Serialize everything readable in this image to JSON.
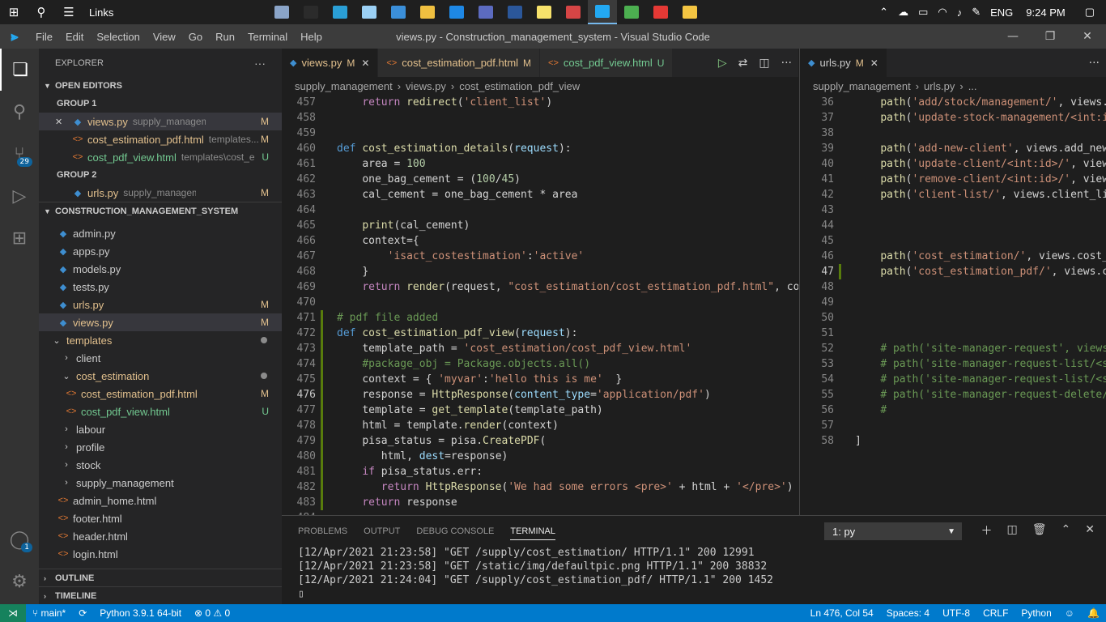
{
  "taskbar": {
    "links_label": "Links",
    "language": "ENG",
    "time": "9:24 PM",
    "apps": [
      {
        "name": "photos-app-icon",
        "color": "#8aa4c8"
      },
      {
        "name": "terminal-app-icon",
        "color": "#2b2b2b"
      },
      {
        "name": "edge-app-icon",
        "color": "#2a9fd6"
      },
      {
        "name": "notepad-app-icon",
        "color": "#9bd0f5"
      },
      {
        "name": "pc-app-icon",
        "color": "#3b8fd9"
      },
      {
        "name": "store-app-icon",
        "color": "#f0c040"
      },
      {
        "name": "mail-app-icon",
        "color": "#1e88e5"
      },
      {
        "name": "calculator-app-icon",
        "color": "#5c6bc0"
      },
      {
        "name": "word-app-icon",
        "color": "#2b579a"
      },
      {
        "name": "sticky-notes-app-icon",
        "color": "#f7e26b"
      },
      {
        "name": "cloud-app-icon",
        "color": "#d64545"
      },
      {
        "name": "vscode-app-icon",
        "color": "#23a9f2"
      },
      {
        "name": "chrome-app-icon",
        "color": "#4caf50"
      },
      {
        "name": "opera-app-icon",
        "color": "#e53935"
      },
      {
        "name": "explorer-app-icon",
        "color": "#f4c542"
      }
    ]
  },
  "titlebar": {
    "logo": "⫸",
    "menu": [
      "File",
      "Edit",
      "Selection",
      "View",
      "Go",
      "Run",
      "Terminal",
      "Help"
    ],
    "window_title": "views.py - Construction_management_system - Visual Studio Code"
  },
  "activity": {
    "scm_badge": "29",
    "account_badge": "1"
  },
  "sidebar": {
    "title": "EXPLORER",
    "open_editors": "OPEN EDITORS",
    "group1": "GROUP 1",
    "group2": "GROUP 2",
    "g1": [
      {
        "name": "views.py",
        "desc": "supply_management",
        "status": "M",
        "type": "py",
        "close": "✕"
      },
      {
        "name": "cost_estimation_pdf.html",
        "desc": "templates...",
        "status": "M",
        "type": "html"
      },
      {
        "name": "cost_pdf_view.html",
        "desc": "templates\\cost_e...",
        "status": "U",
        "type": "html"
      }
    ],
    "g2": [
      {
        "name": "urls.py",
        "desc": "supply_management",
        "status": "M",
        "type": "py"
      }
    ],
    "project": "CONSTRUCTION_MANAGEMENT_SYSTEM",
    "tree": [
      {
        "name": "admin.py",
        "status": ""
      },
      {
        "name": "apps.py",
        "status": ""
      },
      {
        "name": "models.py",
        "status": ""
      },
      {
        "name": "tests.py",
        "status": ""
      },
      {
        "name": "urls.py",
        "status": "M"
      },
      {
        "name": "views.py",
        "status": "M"
      }
    ],
    "templates": "templates",
    "folders_top": [
      "client"
    ],
    "cost_estimation": "cost_estimation",
    "ce_files": [
      {
        "name": "cost_estimation_pdf.html",
        "status": "M"
      },
      {
        "name": "cost_pdf_view.html",
        "status": "U"
      }
    ],
    "folders_bottom": [
      "labour",
      "profile",
      "stock",
      "supply_management"
    ],
    "html_files": [
      "admin_home.html",
      "footer.html",
      "header.html",
      "login.html"
    ],
    "outline": "OUTLINE",
    "timeline": "TIMELINE"
  },
  "editor1": {
    "tabs": [
      {
        "name": "views.py",
        "status": "M",
        "type": "py",
        "active": true
      },
      {
        "name": "cost_estimation_pdf.html",
        "status": "M",
        "type": "html"
      },
      {
        "name": "cost_pdf_view.html",
        "status": "U",
        "type": "html"
      }
    ],
    "breadcrumb": [
      "supply_management",
      "›",
      "views.py",
      "›",
      "cost_estimation_pdf_view"
    ],
    "current_line": "476",
    "lines": [
      {
        "n": "457",
        "html": "    <span class='kw2'>return</span> <span class='fn'>redirect</span><span class='plain'>(</span><span class='str'>'client_list'</span><span class='plain'>)</span>"
      },
      {
        "n": "458",
        "html": ""
      },
      {
        "n": "459",
        "html": ""
      },
      {
        "n": "460",
        "html": "<span class='kw'>def</span> <span class='fn'>cost_estimation_details</span><span class='plain'>(</span><span class='var'>request</span><span class='plain'>):</span>"
      },
      {
        "n": "461",
        "html": "    <span class='plain'>area = </span><span class='num'>100</span>"
      },
      {
        "n": "462",
        "html": "    <span class='plain'>one_bag_cement = (</span><span class='num'>100</span><span class='plain'>/</span><span class='num'>45</span><span class='plain'>)</span>"
      },
      {
        "n": "463",
        "html": "    <span class='plain'>cal_cement = one_bag_cement * area</span>"
      },
      {
        "n": "464",
        "html": ""
      },
      {
        "n": "465",
        "html": "    <span class='fn'>print</span><span class='plain'>(cal_cement)</span>"
      },
      {
        "n": "466",
        "html": "    <span class='plain'>context={</span>"
      },
      {
        "n": "467",
        "html": "        <span class='str'>'isact_costestimation'</span><span class='plain'>:</span><span class='str'>'active'</span>"
      },
      {
        "n": "468",
        "html": "    <span class='plain'>}</span>"
      },
      {
        "n": "469",
        "html": "    <span class='kw2'>return</span> <span class='fn'>render</span><span class='plain'>(request, </span><span class='str'>\"cost_estimation/cost_estimation_pdf.html\"</span><span class='plain'>, con</span>"
      },
      {
        "n": "470",
        "html": ""
      },
      {
        "n": "471",
        "html": "<span class='cm'># pdf file added</span>",
        "mod": true
      },
      {
        "n": "472",
        "html": "<span class='kw'>def</span> <span class='fn'>cost_estimation_pdf_view</span><span class='plain'>(</span><span class='var'>request</span><span class='plain'>):</span>",
        "mod": true
      },
      {
        "n": "473",
        "html": "    <span class='plain'>template_path = </span><span class='str'>'cost_estimation/cost_pdf_view.html'</span>",
        "mod": true
      },
      {
        "n": "474",
        "html": "    <span class='cm'>#package_obj = Package.objects.all()</span>",
        "mod": true
      },
      {
        "n": "475",
        "html": "    <span class='plain'>context = { </span><span class='str'>'myvar'</span><span class='plain'>:</span><span class='str'>'hello this is me'</span><span class='plain'>  }</span>",
        "mod": true
      },
      {
        "n": "476",
        "html": "    <span class='plain'>response = </span><span class='fn'>HttpResponse</span><span class='plain'>(</span><span class='var'>content_type</span><span class='plain'>=</span><span class='str'>'application/pdf'</span><span class='plain'>)</span>",
        "mod": true
      },
      {
        "n": "477",
        "html": "    <span class='plain'>template = </span><span class='fn'>get_template</span><span class='plain'>(template_path)</span>",
        "mod": true
      },
      {
        "n": "478",
        "html": "    <span class='plain'>html = template.</span><span class='fn'>render</span><span class='plain'>(context)</span>",
        "mod": true
      },
      {
        "n": "479",
        "html": "    <span class='plain'>pisa_status = pisa.</span><span class='fn'>CreatePDF</span><span class='plain'>(</span>",
        "mod": true
      },
      {
        "n": "480",
        "html": "       <span class='plain'>html, </span><span class='var'>dest</span><span class='plain'>=response)</span>",
        "mod": true
      },
      {
        "n": "481",
        "html": "    <span class='kw2'>if</span> <span class='plain'>pisa_status.err:</span>",
        "mod": true
      },
      {
        "n": "482",
        "html": "       <span class='kw2'>return</span> <span class='fn'>HttpResponse</span><span class='plain'>(</span><span class='str'>'We had some errors &lt;pre&gt;'</span><span class='plain'> + html + </span><span class='str'>'&lt;/pre&gt;'</span><span class='plain'>)</span>",
        "mod": true
      },
      {
        "n": "483",
        "html": "    <span class='kw2'>return</span> <span class='plain'>response</span>",
        "mod": true
      },
      {
        "n": "484",
        "html": ""
      }
    ]
  },
  "editor2": {
    "tab": {
      "name": "urls.py",
      "status": "M"
    },
    "breadcrumb": [
      "supply_management",
      "›",
      "urls.py",
      "›",
      "..."
    ],
    "current_line": "47",
    "lines": [
      {
        "n": "36",
        "html": "    <span class='fn'>path</span><span class='plain'>(</span><span class='str'>'add/stock/management/'</span><span class='plain'>, views.a</span>"
      },
      {
        "n": "37",
        "html": "    <span class='fn'>path</span><span class='plain'>(</span><span class='str'>'update-stock-management/&lt;int:id</span>"
      },
      {
        "n": "38",
        "html": ""
      },
      {
        "n": "39",
        "html": "    <span class='fn'>path</span><span class='plain'>(</span><span class='str'>'add-new-client'</span><span class='plain'>, views.add_new_</span>"
      },
      {
        "n": "40",
        "html": "    <span class='fn'>path</span><span class='plain'>(</span><span class='str'>'update-client/&lt;int:id&gt;/'</span><span class='plain'>, views</span>"
      },
      {
        "n": "41",
        "html": "    <span class='fn'>path</span><span class='plain'>(</span><span class='str'>'remove-client/&lt;int:id&gt;/'</span><span class='plain'>, views</span>"
      },
      {
        "n": "42",
        "html": "    <span class='fn'>path</span><span class='plain'>(</span><span class='str'>'client-list/'</span><span class='plain'>, views.client_lis</span>"
      },
      {
        "n": "43",
        "html": ""
      },
      {
        "n": "44",
        "html": ""
      },
      {
        "n": "45",
        "html": ""
      },
      {
        "n": "46",
        "html": "    <span class='fn'>path</span><span class='plain'>(</span><span class='str'>'cost_estimation/'</span><span class='plain'>, views.cost_e</span>"
      },
      {
        "n": "47",
        "html": "    <span class='fn'>path</span><span class='plain'>(</span><span class='str'>'cost_estimation_pdf/'</span><span class='plain'>, views.co</span>",
        "mod": true
      },
      {
        "n": "48",
        "html": ""
      },
      {
        "n": "49",
        "html": ""
      },
      {
        "n": "50",
        "html": ""
      },
      {
        "n": "51",
        "html": ""
      },
      {
        "n": "52",
        "html": "    <span class='cm'># path('site-manager-request', views.</span>"
      },
      {
        "n": "53",
        "html": "    <span class='cm'># path('site-manager-request-list/&lt;st</span>"
      },
      {
        "n": "54",
        "html": "    <span class='cm'># path('site-manager-request-list/&lt;st</span>"
      },
      {
        "n": "55",
        "html": "    <span class='cm'># path('site-manager-request-delete/&lt;</span>"
      },
      {
        "n": "56",
        "html": "    <span class='cm'>#</span>"
      },
      {
        "n": "57",
        "html": ""
      },
      {
        "n": "58",
        "html": "<span class='plain'>]</span>"
      }
    ]
  },
  "panel": {
    "tabs": [
      "PROBLEMS",
      "OUTPUT",
      "DEBUG CONSOLE",
      "TERMINAL"
    ],
    "active_tab": "TERMINAL",
    "terminal_select": "1: py",
    "lines": [
      "[12/Apr/2021 21:23:58] \"GET /supply/cost_estimation/ HTTP/1.1\" 200 12991",
      "[12/Apr/2021 21:23:58] \"GET /static/img/defaultpic.png HTTP/1.1\" 200 38832",
      "[12/Apr/2021 21:24:04] \"GET /supply/cost_estimation_pdf/ HTTP/1.1\" 200 1452"
    ],
    "prompt": "▯"
  },
  "status": {
    "branch": "main*",
    "python": "Python 3.9.1 64-bit",
    "errors": "⊗ 0 ⚠ 0",
    "position": "Ln 476, Col 54",
    "spaces": "Spaces: 4",
    "encoding": "UTF-8",
    "eol": "CRLF",
    "language": "Python"
  }
}
